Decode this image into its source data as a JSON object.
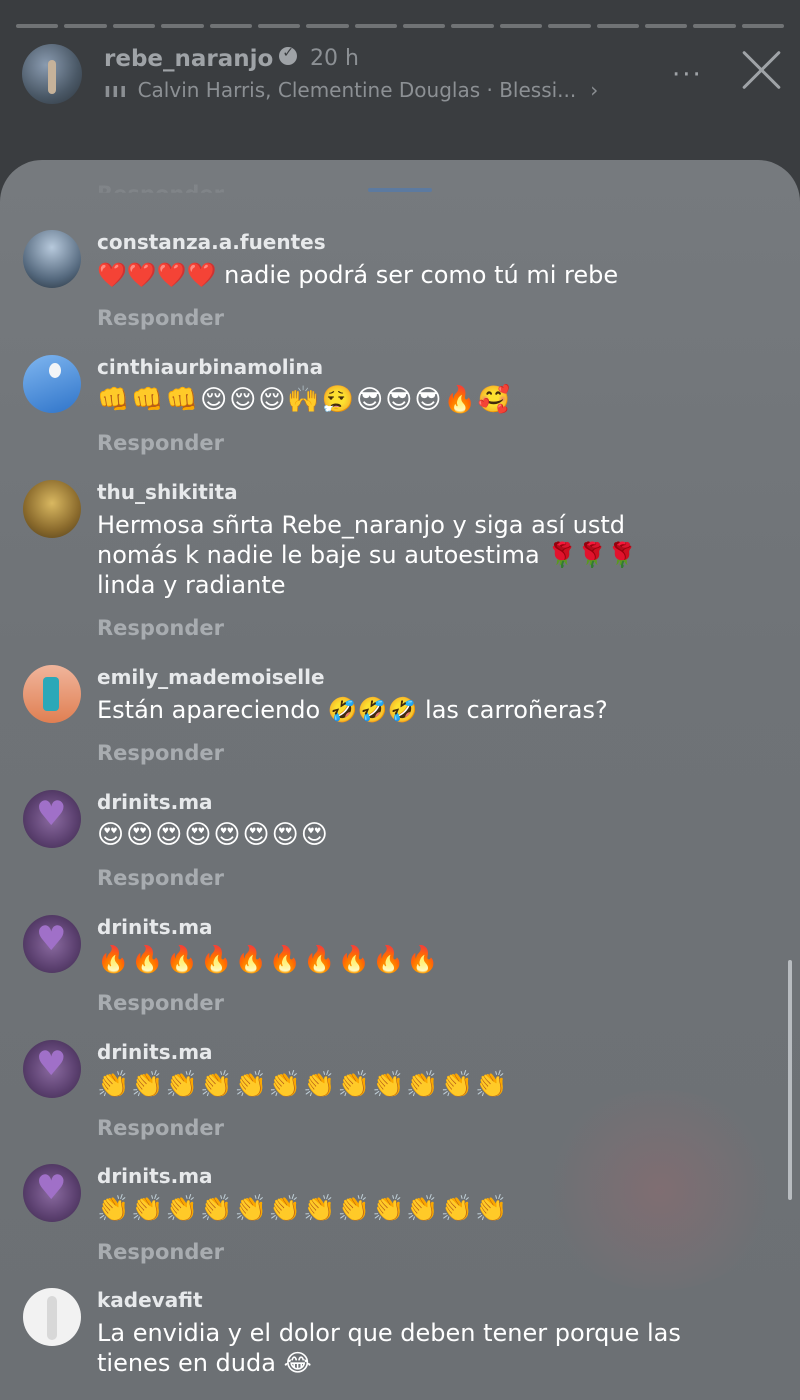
{
  "story": {
    "username": "rebe_naranjo",
    "time": "20 h",
    "music": "Calvin Harris, Clementine Douglas · Blessi...",
    "music_icon": "bars-icon",
    "chevron": "›",
    "more": "···"
  },
  "sheet": {
    "ghost_text": "Responder"
  },
  "comments": [
    {
      "username": "constanza.a.fuentes",
      "text": "❤️❤️❤️❤️ nadie podrá ser como tú mi rebe",
      "reply": "Responder"
    },
    {
      "username": "cinthiaurbinamolina",
      "text": "👊👊👊😌😌😌🙌😮‍💨😎😎😎🔥🥰",
      "reply": "Responder"
    },
    {
      "username": "thu_shikitita",
      "text": "Hermosa sñrta Rebe_naranjo y siga así ustd nomás k nadie le baje su autoestima 🌹🌹🌹\nlinda y radiante",
      "reply": "Responder"
    },
    {
      "username": "emily_mademoiselle",
      "text": "Están apareciendo 🤣🤣🤣 las carroñeras?",
      "reply": "Responder"
    },
    {
      "username": "drinits.ma",
      "text": "😍😍😍😍😍😍😍😍",
      "reply": "Responder"
    },
    {
      "username": "drinits.ma",
      "text": "🔥🔥🔥🔥🔥🔥🔥🔥🔥🔥",
      "reply": "Responder"
    },
    {
      "username": "drinits.ma",
      "text": "👏👏👏👏👏👏👏👏👏👏👏👏",
      "reply": "Responder"
    },
    {
      "username": "drinits.ma",
      "text": "👏👏👏👏👏👏👏👏👏👏👏👏",
      "reply": "Responder"
    },
    {
      "username": "kadevafit",
      "text": "La envidia y el dolor que deben tener porque las tienes en duda 😂",
      "reply": ""
    }
  ]
}
